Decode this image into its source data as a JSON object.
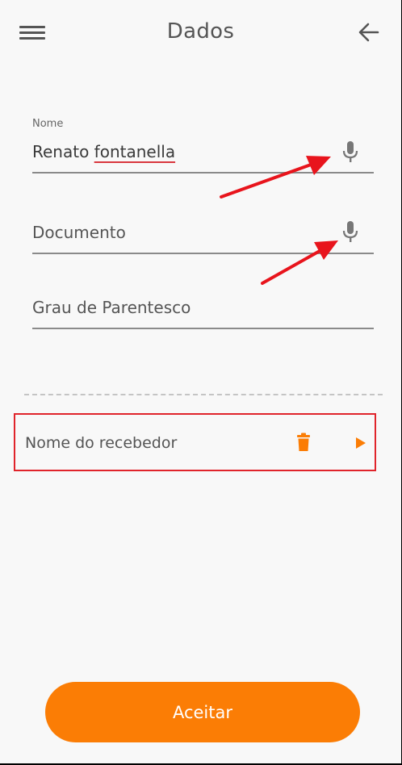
{
  "header": {
    "title": "Dados",
    "menu_icon": "hamburger-menu-icon",
    "back_icon": "arrow-left-icon"
  },
  "form": {
    "nome": {
      "label": "Nome",
      "value_first": "Renato ",
      "value_misspelled": "fontanella",
      "icon": "microphone-icon"
    },
    "documento": {
      "placeholder": "Documento",
      "icon": "microphone-icon"
    },
    "grau": {
      "placeholder": "Grau de Parentesco"
    }
  },
  "receiver": {
    "label": "Nome do recebedor",
    "delete_icon": "trash-icon",
    "expand_icon": "play-triangle-icon"
  },
  "annotations": {
    "arrow_color": "#e8141c",
    "box_color": "#e0242b"
  },
  "actions": {
    "accept_label": "Aceitar"
  },
  "colors": {
    "accent": "#fb7d05",
    "background": "#f8f8f8",
    "text": "#555555"
  }
}
